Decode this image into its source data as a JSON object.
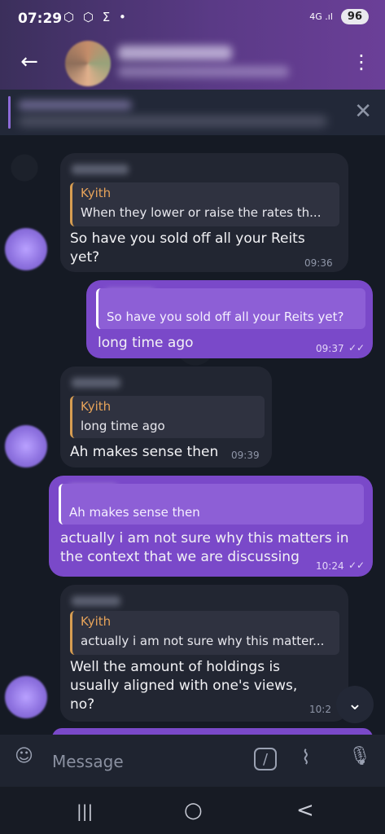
{
  "status_bar": {
    "time": "07:29",
    "icons": "⬡ ⬡ Σ •",
    "network": "4G .ıl",
    "battery": "96"
  },
  "header": {
    "back_label": "←",
    "menu_label": "⋮"
  },
  "pinned": {
    "close_label": "✕"
  },
  "messages": [
    {
      "reply_name": "Kyith",
      "reply_text": "When they lower or raise the rates th...",
      "text": "So have you sold off all your Reits yet?",
      "time": "09:36"
    },
    {
      "reply_text": "So have you sold off all your Reits yet?",
      "text": "long time ago",
      "time": "09:37"
    },
    {
      "reply_name": "Kyith",
      "reply_text": "long time ago",
      "text": "Ah makes sense then",
      "time": "09:39"
    },
    {
      "reply_text": "Ah makes sense then",
      "text": "actually i am not sure why this matters in the context that we are discussing",
      "time": "10:24"
    },
    {
      "reply_name": "Kyith",
      "reply_text": "actually i am not sure why this matter...",
      "text": "Well the amount of holdings is usually aligned with one's views, no?",
      "time": "10:2"
    }
  ],
  "read_receipt": "✓✓",
  "input": {
    "placeholder": "Message",
    "command_label": "/"
  },
  "navbar": {
    "recent": "|||",
    "home": "○",
    "back": "<"
  },
  "colors": {
    "accent": "#7a49c9",
    "incoming_bubble": "#222632",
    "reply_name": "#e6a35a",
    "background": "#151a24"
  },
  "icons": [
    "back-arrow-icon",
    "more-vert-icon",
    "close-icon",
    "emoji-icon",
    "command-icon",
    "attach-icon",
    "mic-icon",
    "chevron-down-icon"
  ]
}
